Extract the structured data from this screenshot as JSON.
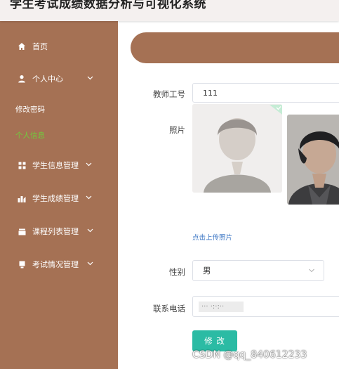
{
  "app": {
    "title": "学生考试成绩数据分析与可视化系统"
  },
  "sidebar": {
    "items": [
      {
        "label": "首页",
        "icon": "home-icon"
      },
      {
        "label": "个人中心",
        "icon": "user-icon",
        "expanded": true
      },
      {
        "label": "学生信息管理",
        "icon": "grid-icon"
      },
      {
        "label": "学生成绩管理",
        "icon": "chart-icon"
      },
      {
        "label": "课程列表管理",
        "icon": "list-icon"
      },
      {
        "label": "考试情况管理",
        "icon": "document-icon"
      }
    ],
    "sub_items": [
      {
        "label": "修改密码"
      },
      {
        "label": "个人信息",
        "active": true
      }
    ]
  },
  "form": {
    "teacher_id": {
      "label": "教师工号",
      "value": "111"
    },
    "photo": {
      "label": "照片",
      "upload_hint": "点击上传照片"
    },
    "gender": {
      "label": "性别",
      "value": "男"
    },
    "phone": {
      "label": "联系电话",
      "value": "··· ·:·:··"
    },
    "submit_label": "修 改"
  },
  "watermark": "CSDN @qq_840612233",
  "colors": {
    "sidebar_bg": "#a57154",
    "active_sub": "#6fcf3c",
    "submit_bg": "#2bbba4",
    "link": "#3b76c4"
  }
}
